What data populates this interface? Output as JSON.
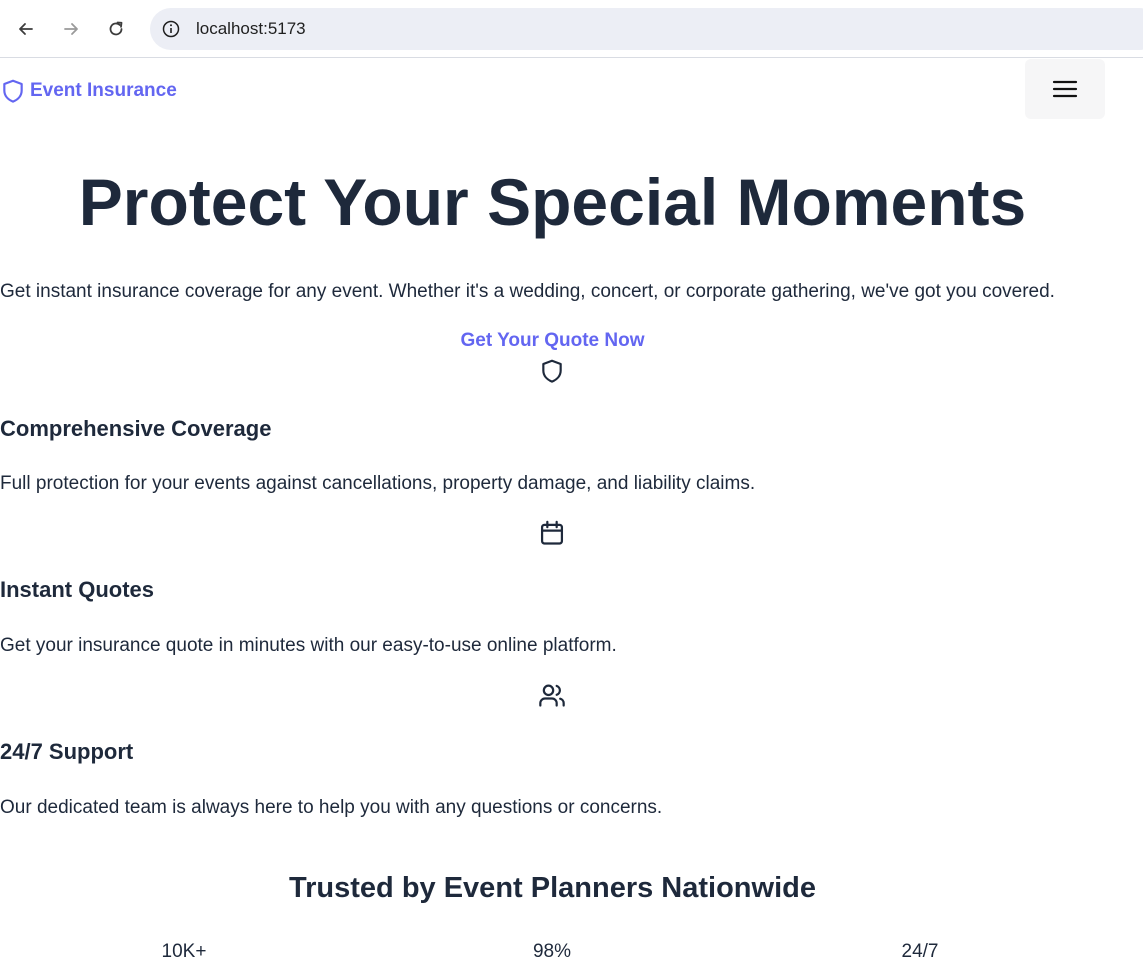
{
  "browser": {
    "url": "localhost:5173",
    "icons": [
      "back-arrow-icon",
      "forward-arrow-icon",
      "reload-icon",
      "info-icon"
    ]
  },
  "header": {
    "brand": "Event Insurance",
    "brand_icon": "shield-icon",
    "menu_icon": "hamburger-menu-icon"
  },
  "hero": {
    "title": "Protect Your Special Moments",
    "subtitle": "Get instant insurance coverage for any event. Whether it's a wedding, concert, or corporate gathering, we've got you covered.",
    "cta": "Get Your Quote Now"
  },
  "features": [
    {
      "icon": "shield-icon",
      "title": "Comprehensive Coverage",
      "description": "Full protection for your events against cancellations, property damage, and liability claims."
    },
    {
      "icon": "calendar-icon",
      "title": "Instant Quotes",
      "description": "Get your insurance quote in minutes with our easy-to-use online platform."
    },
    {
      "icon": "users-icon",
      "title": "24/7 Support",
      "description": "Our dedicated team is always here to help you with any questions or concerns."
    }
  ],
  "stats": {
    "title": "Trusted by Event Planners Nationwide",
    "items": [
      {
        "value": "10K+"
      },
      {
        "value": "98%"
      },
      {
        "value": "24/7"
      }
    ]
  },
  "colors": {
    "accent": "#6366f1",
    "text": "#1e293b",
    "omnibox": "#eceef5",
    "menu_button_bg": "#f6f6f7"
  }
}
